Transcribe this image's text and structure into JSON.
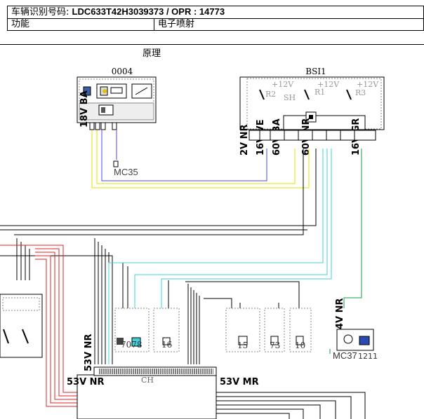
{
  "header": {
    "vin_label": "车辆识别号码:",
    "vin_value": "LDC633T42H3039373 / OPR : 14773",
    "function_label": "功能",
    "function_value": "电子喷射"
  },
  "diagram": {
    "section_title": "原理",
    "components": {
      "c0004": "0004",
      "bsi1": "BSI1",
      "ch": "CH",
      "mc35": "MC35",
      "mc37": "MC37",
      "mc37_sub": "1211"
    },
    "connectors": {
      "c0004_conn": "18V BA",
      "bsi_a": "2V NR",
      "bsi_b": "16V VE",
      "bsi_c": "60V BA",
      "bsi_d": "60V NR",
      "bsi_e": "16V GR",
      "mc37_conn": "4V NR",
      "ch_left": "53V NR",
      "ch_right": "53V MR"
    },
    "relays": {
      "r2": "R2",
      "sh": "SH",
      "r1": "R1",
      "r3": "R3",
      "v12a": "+12V",
      "v12b": "+12V",
      "v12c": "+12V"
    },
    "boxes": {
      "b1_num": "7078",
      "b2_num": "16",
      "b3_num": "15",
      "b4_num": "73",
      "b5_num": "10"
    }
  }
}
